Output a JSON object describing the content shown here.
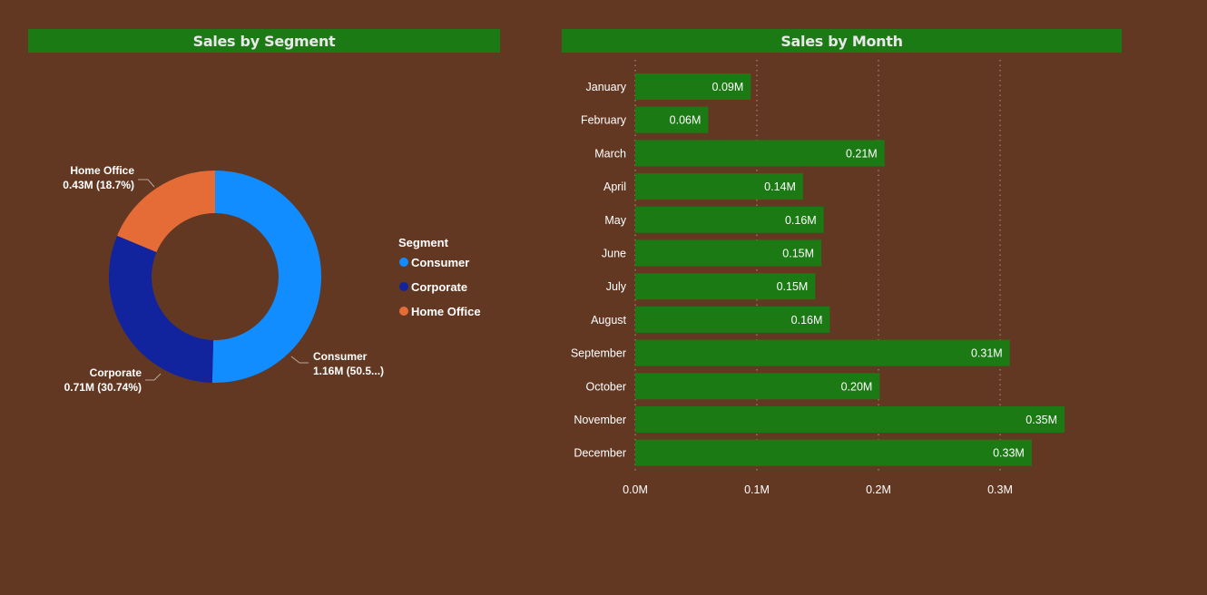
{
  "charts_title": {
    "segment": "Sales by Segment",
    "month": "Sales by Month"
  },
  "colors": {
    "background": "#633823",
    "title_bar": "#1c7a14",
    "bar": "#1c7a14",
    "consumer": "#118dff",
    "corporate": "#12239e",
    "home_office": "#e66c37"
  },
  "chart_data": [
    {
      "type": "donut",
      "title": "Sales by Segment",
      "legend_title": "Segment",
      "legend_position": "right",
      "slices": [
        {
          "name": "Consumer",
          "value": 1.16,
          "label": "Consumer",
          "value_label": "1.16M (50.5...)"
        },
        {
          "name": "Corporate",
          "value": 0.71,
          "label": "Corporate",
          "value_label": "0.71M (30.74%)"
        },
        {
          "name": "Home Office",
          "value": 0.43,
          "label": "Home Office",
          "value_label": "0.43M (18.7%)"
        }
      ]
    },
    {
      "type": "bar",
      "orientation": "horizontal",
      "title": "Sales by Month",
      "categories": [
        "January",
        "February",
        "March",
        "April",
        "May",
        "June",
        "July",
        "August",
        "September",
        "October",
        "November",
        "December"
      ],
      "values": [
        0.095,
        0.06,
        0.205,
        0.138,
        0.155,
        0.153,
        0.148,
        0.16,
        0.308,
        0.201,
        0.353,
        0.326
      ],
      "data_labels": [
        "0.09M",
        "0.06M",
        "0.21M",
        "0.14M",
        "0.16M",
        "0.15M",
        "0.15M",
        "0.16M",
        "0.31M",
        "0.20M",
        "0.35M",
        "0.33M"
      ],
      "xlim": [
        0,
        0.3
      ],
      "x_ticks": [
        0,
        0.1,
        0.2,
        0.3
      ],
      "x_tick_labels": [
        "0.0M",
        "0.1M",
        "0.2M",
        "0.3M"
      ],
      "grid": true
    }
  ]
}
